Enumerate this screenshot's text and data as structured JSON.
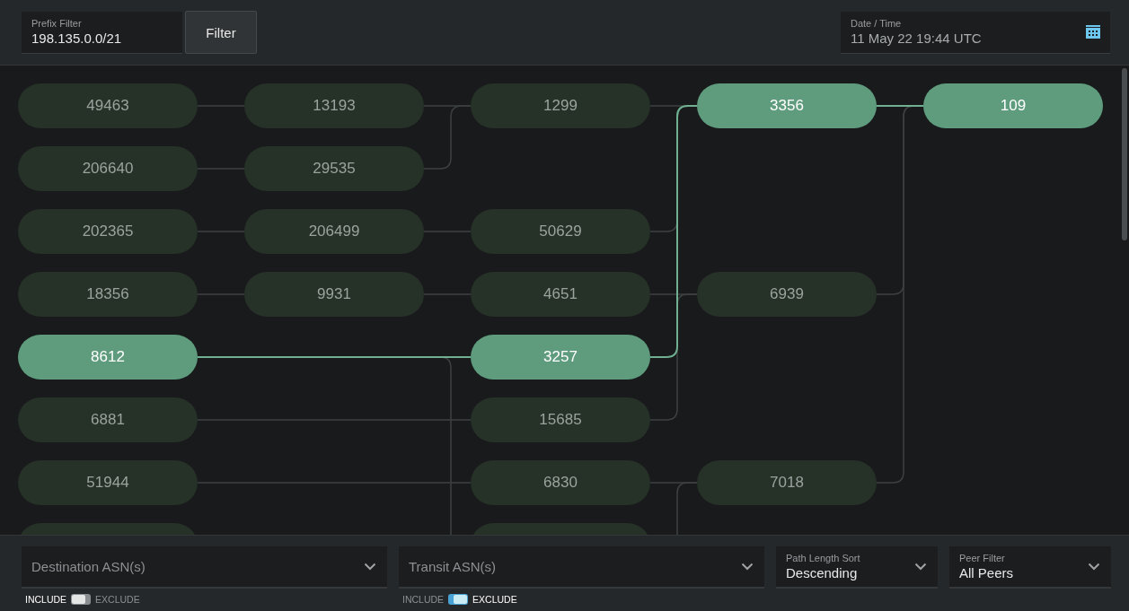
{
  "top_bar": {
    "prefix_filter": {
      "label": "Prefix Filter",
      "value": "198.135.0.0/21"
    },
    "filter_button": "Filter",
    "date_time": {
      "label": "Date / Time",
      "value": "11 May 22 19:44 UTC"
    }
  },
  "graph": {
    "rows": [
      [
        {
          "label": "49463",
          "selected": false
        },
        {
          "label": "13193",
          "selected": false
        },
        {
          "label": "1299",
          "selected": false
        },
        {
          "label": "3356",
          "selected": true
        },
        {
          "label": "109",
          "selected": true
        }
      ],
      [
        {
          "label": "206640",
          "selected": false
        },
        {
          "label": "29535",
          "selected": false
        },
        null,
        null,
        null
      ],
      [
        {
          "label": "202365",
          "selected": false
        },
        {
          "label": "206499",
          "selected": false
        },
        {
          "label": "50629",
          "selected": false
        },
        null,
        null
      ],
      [
        {
          "label": "18356",
          "selected": false
        },
        {
          "label": "9931",
          "selected": false
        },
        {
          "label": "4651",
          "selected": false
        },
        {
          "label": "6939",
          "selected": false
        },
        null
      ],
      [
        {
          "label": "8612",
          "selected": true
        },
        null,
        {
          "label": "3257",
          "selected": true
        },
        null,
        null
      ],
      [
        {
          "label": "6881",
          "selected": false
        },
        null,
        {
          "label": "15685",
          "selected": false
        },
        null,
        null
      ],
      [
        {
          "label": "51944",
          "selected": false
        },
        null,
        {
          "label": "6830",
          "selected": false
        },
        {
          "label": "7018",
          "selected": false
        },
        null
      ],
      [
        {
          "selected": false
        },
        null,
        {
          "selected": false
        },
        null,
        null
      ]
    ]
  },
  "filters": [
    {
      "kind": "select",
      "placeholder": "Destination ASN(s)",
      "toggle": {
        "left": "INCLUDE",
        "right": "EXCLUDE",
        "exclude": false
      }
    },
    {
      "kind": "select",
      "placeholder": "Transit ASN(s)",
      "toggle": {
        "left": "INCLUDE",
        "right": "EXCLUDE",
        "exclude": true
      }
    },
    {
      "kind": "labeled",
      "label": "Path Length Sort",
      "value": "Descending"
    },
    {
      "kind": "labeled",
      "label": "Peer Filter",
      "value": "All Peers"
    }
  ]
}
